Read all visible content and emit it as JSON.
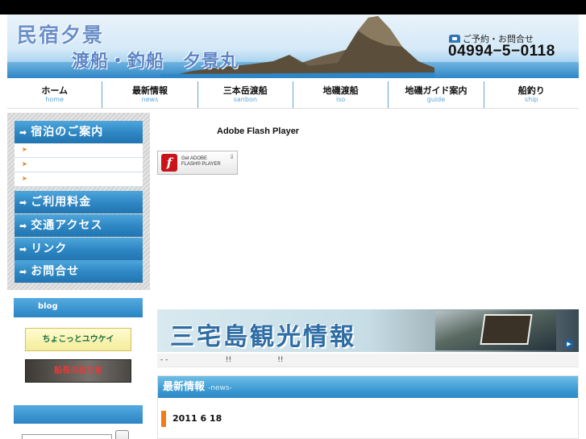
{
  "header": {
    "inn_name": "民宿夕景",
    "subtitle": "渡船・釣船　夕景丸",
    "reservation_label": "ご予約・お問合せ",
    "phone": "04994−5−0118"
  },
  "nav": [
    {
      "jp": "ホーム",
      "en": "home"
    },
    {
      "jp": "最新情報",
      "en": "news"
    },
    {
      "jp": "三本岳渡船",
      "en": "sanbon"
    },
    {
      "jp": "地磯渡船",
      "en": "iso"
    },
    {
      "jp": "地磯ガイド案内",
      "en": "guide"
    },
    {
      "jp": "船釣り",
      "en": "ship"
    }
  ],
  "sidebar": {
    "menu_top": "宿泊のご案内",
    "sub_arrow": "➤",
    "menu_items": [
      "ご利用料金",
      "交通アクセス",
      "リンク",
      "お問合せ"
    ],
    "arrow": "➡"
  },
  "blog": {
    "heading": "blog",
    "banner1": "ちょこっとユウケイ",
    "banner2": "船長の独り言"
  },
  "flash": {
    "title": "Adobe Flash Player",
    "badge_get": "Get ADOBE",
    "badge_product": "FLASH® PLAYER",
    "badge_letter": "f",
    "download_icon": "⇓"
  },
  "tourism_banner": {
    "text": "三宅島観光情報",
    "go_icon": "▶"
  },
  "ticker": "- -                         !!                    !!",
  "news": {
    "heading": "最新情報",
    "heading_sub": "-news-",
    "date": "2011  6  18"
  },
  "colors": {
    "nav_accent": "#5aa6d6",
    "menu_blue": "#2d86c2",
    "news_marker": "#f07d1a"
  }
}
